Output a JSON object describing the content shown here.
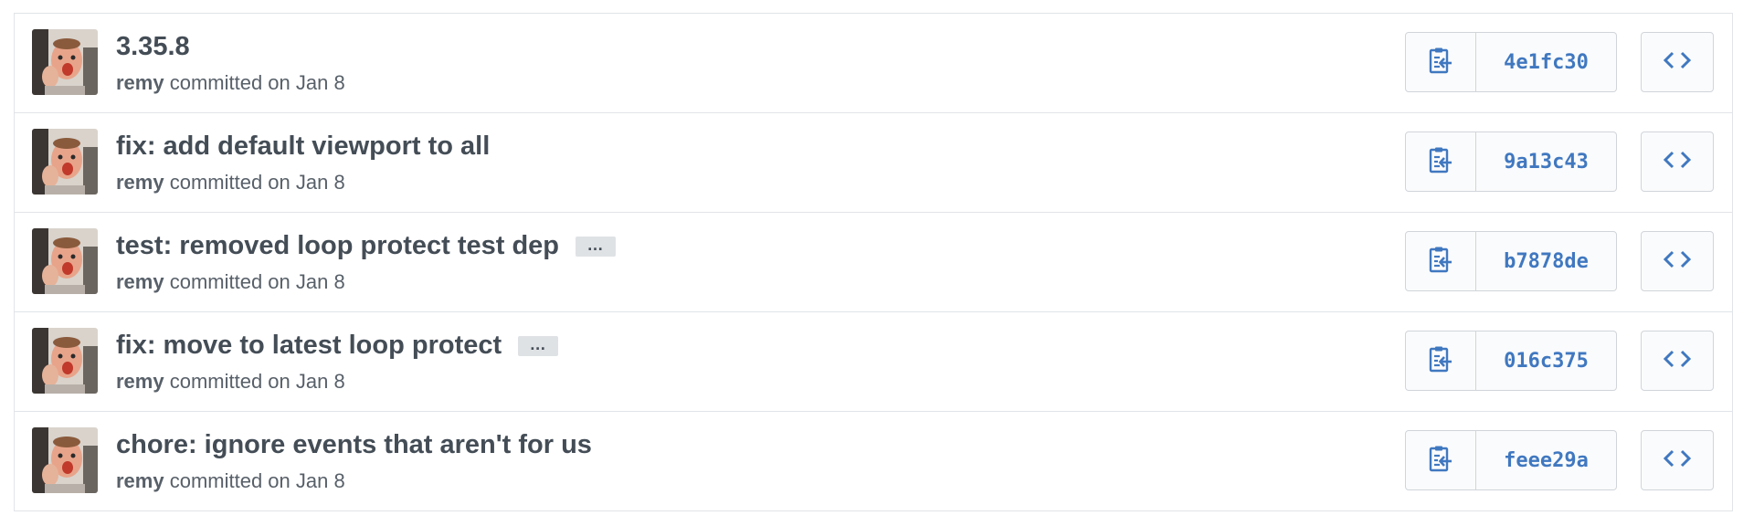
{
  "colors": {
    "link": "#4078c0",
    "title": "#444d56",
    "meta": "#586069",
    "border": "#e1e4e8"
  },
  "icons": {
    "copy": "clippy-icon",
    "browse": "code-icon"
  },
  "commits": [
    {
      "title": "3.35.8",
      "has_ellipsis": false,
      "ellipsis": "",
      "author": "remy",
      "meta": "committed on Jan 8",
      "sha": "4e1fc30"
    },
    {
      "title": "fix: add default viewport to all",
      "has_ellipsis": false,
      "ellipsis": "",
      "author": "remy",
      "meta": "committed on Jan 8",
      "sha": "9a13c43"
    },
    {
      "title": "test: removed loop protect test dep",
      "has_ellipsis": true,
      "ellipsis": "…",
      "author": "remy",
      "meta": "committed on Jan 8",
      "sha": "b7878de"
    },
    {
      "title": "fix: move to latest loop protect",
      "has_ellipsis": true,
      "ellipsis": "…",
      "author": "remy",
      "meta": "committed on Jan 8",
      "sha": "016c375"
    },
    {
      "title": "chore: ignore events that aren't for us",
      "has_ellipsis": false,
      "ellipsis": "",
      "author": "remy",
      "meta": "committed on Jan 8",
      "sha": "feee29a"
    }
  ]
}
